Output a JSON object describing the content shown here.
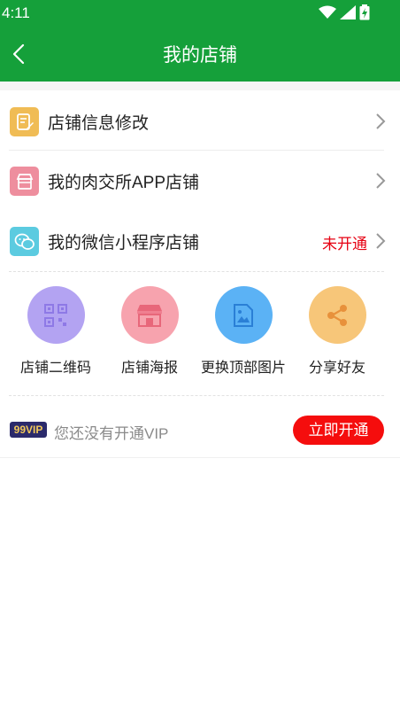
{
  "status_bar": {
    "time": "4:11"
  },
  "header": {
    "title": "我的店铺"
  },
  "menu": [
    {
      "label": "店铺信息修改",
      "status": ""
    },
    {
      "label": "我的肉交所APP店铺",
      "status": ""
    },
    {
      "label": "我的微信小程序店铺",
      "status": "未开通"
    }
  ],
  "tools": [
    {
      "label": "店铺二维码"
    },
    {
      "label": "店铺海报"
    },
    {
      "label": "更换顶部图片"
    },
    {
      "label": "分享好友"
    }
  ],
  "vip": {
    "badge": "99VIP",
    "text": "您还没有开通VIP",
    "button": "立即开通"
  },
  "colors": {
    "brand_green": "#15a03a",
    "status_red": "#e60012",
    "vip_button": "#f50d0d"
  }
}
